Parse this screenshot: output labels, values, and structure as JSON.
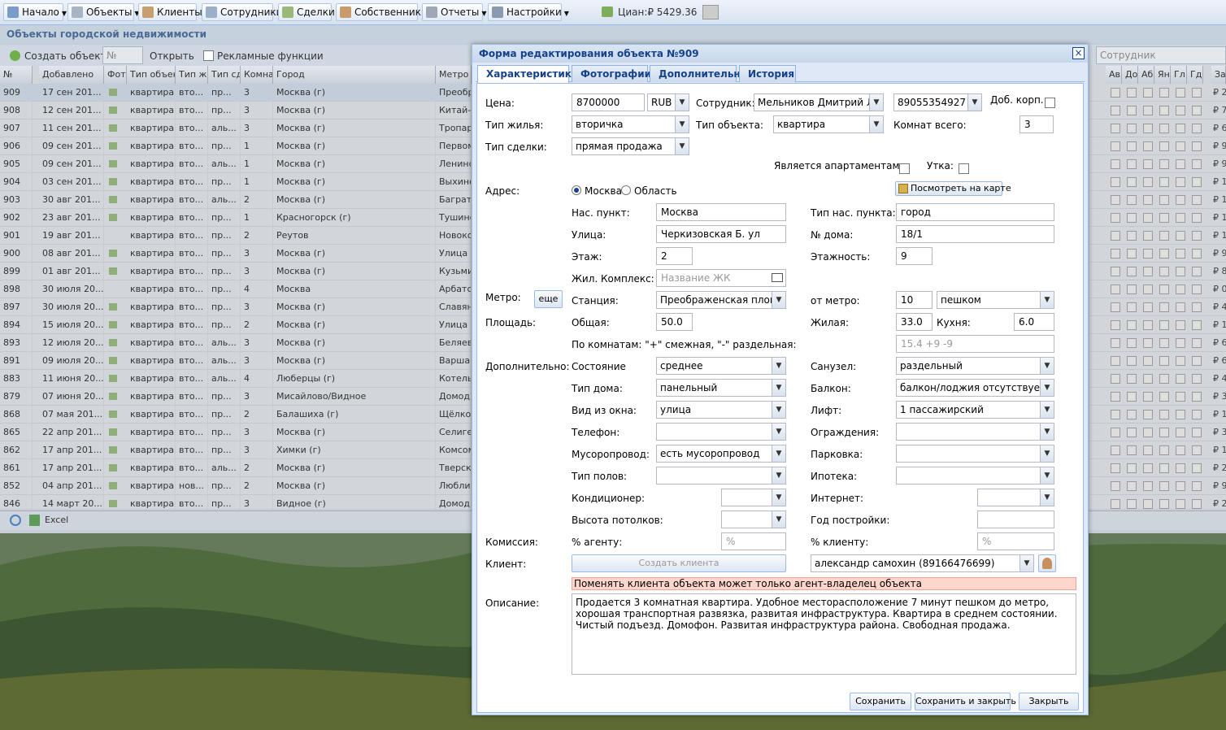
{
  "toolbar": {
    "items": [
      "Начало",
      "Объекты",
      "Клиенты",
      "Сотрудники",
      "Сделки",
      "Собственники",
      "Отчеты",
      "Настройки"
    ],
    "cian": "Циан:₽ 5429.36"
  },
  "panel": {
    "title": "Объекты городской недвижимости",
    "create": "Создать объект",
    "num_placeholder": "№",
    "open": "Открыть",
    "ads": "Рекламные функции",
    "employee_placeholder": "Сотрудник",
    "excel": "Excel"
  },
  "grid": {
    "headers": [
      "№",
      "Добавлено",
      "Фото",
      "Тип объект",
      "Тип жи",
      "Тип сд",
      "Комнат",
      "Город",
      "Метро"
    ],
    "right_headers": [
      "Ав",
      "До",
      "Аб",
      "Ян",
      "Гл",
      "Гд",
      "Затрат"
    ],
    "rows": [
      [
        "909",
        "17 сен 201...",
        "квартира",
        "вто...",
        "пр...",
        "3",
        "Москва (г)",
        "Преобр",
        "₽ 2..."
      ],
      [
        "908",
        "12 сен 201...",
        "квартира",
        "вто...",
        "пр...",
        "3",
        "Москва (г)",
        "Китай-г",
        "₽ 7..."
      ],
      [
        "907",
        "11 сен 201...",
        "квартира",
        "вто...",
        "аль...",
        "3",
        "Москва (г)",
        "Тропар",
        "₽ 6..."
      ],
      [
        "906",
        "09 сен 201...",
        "квартира",
        "вто...",
        "пр...",
        "1",
        "Москва (г)",
        "Первом",
        "₽ 9..."
      ],
      [
        "905",
        "09 сен 201...",
        "квартира",
        "вто...",
        "аль...",
        "1",
        "Москва (г)",
        "Ленинс",
        "₽ 9..."
      ],
      [
        "904",
        "03 сен 201...",
        "квартира",
        "вто...",
        "пр...",
        "1",
        "Москва (г)",
        "Выхино",
        "₽ 1..."
      ],
      [
        "903",
        "30 авг 201...",
        "квартира",
        "вто...",
        "аль...",
        "2",
        "Москва (г)",
        "Багратн",
        "₽ 1..."
      ],
      [
        "902",
        "23 авг 201...",
        "квартира",
        "вто...",
        "пр...",
        "1",
        "Красногорск (г)",
        "Тушинс",
        "₽ 1..."
      ],
      [
        "901",
        "19 авг 201...",
        "квартира",
        "вто...",
        "пр...",
        "2",
        "Реутов",
        "Новоко",
        "₽ 1..."
      ],
      [
        "900",
        "08 авг 201...",
        "квартира",
        "вто...",
        "пр...",
        "3",
        "Москва (г)",
        "Улица А",
        "₽ 9..."
      ],
      [
        "899",
        "01 авг 201...",
        "квартира",
        "вто...",
        "пр...",
        "3",
        "Москва (г)",
        "Кузьми",
        "₽ 8..."
      ],
      [
        "898",
        "30 июля 20...",
        "квартира",
        "вто...",
        "пр...",
        "4",
        "Москва",
        "Арбатск",
        "₽ 0..."
      ],
      [
        "897",
        "30 июля 20...",
        "квартира",
        "вто...",
        "пр...",
        "3",
        "Москва (г)",
        "Славян",
        "₽ 4..."
      ],
      [
        "894",
        "15 июля 20...",
        "квартира",
        "вто...",
        "пр...",
        "2",
        "Москва (г)",
        "Улица Е",
        "₽ 1..."
      ],
      [
        "893",
        "12 июля 20...",
        "квартира",
        "вто...",
        "аль...",
        "3",
        "Москва (г)",
        "Беляев",
        "₽ 6..."
      ],
      [
        "891",
        "09 июля 20...",
        "квартира",
        "вто...",
        "аль...",
        "3",
        "Москва (г)",
        "Варшав",
        "₽ 6..."
      ],
      [
        "883",
        "11 июня 20...",
        "квартира",
        "вто...",
        "аль...",
        "4",
        "Люберцы (г)",
        "Котель",
        "₽ 4..."
      ],
      [
        "879",
        "07 июня 20...",
        "квартира",
        "вто...",
        "пр...",
        "3",
        "Мисайлово/Видное",
        "Домод",
        "₽ 3..."
      ],
      [
        "868",
        "07 мая 201...",
        "квартира",
        "вто...",
        "пр...",
        "2",
        "Балашиха (г)",
        "Щёлков",
        "₽ 1..."
      ],
      [
        "865",
        "22 апр 201...",
        "квартира",
        "вто...",
        "пр...",
        "3",
        "Москва (г)",
        "Селигер",
        "₽ 3..."
      ],
      [
        "862",
        "17 апр 201...",
        "квартира",
        "вто...",
        "пр...",
        "3",
        "Химки (г)",
        "Комсом",
        "₽ 1..."
      ],
      [
        "861",
        "17 апр 201...",
        "квартира",
        "вто...",
        "аль...",
        "2",
        "Москва (г)",
        "Тверска",
        "₽ 2..."
      ],
      [
        "852",
        "04 апр 201...",
        "квартира",
        "нов...",
        "пр...",
        "2",
        "Москва (г)",
        "Люблин",
        "₽ 9..."
      ],
      [
        "846",
        "14 март 20...",
        "квартира",
        "вто...",
        "пр...",
        "3",
        "Видное (г)",
        "Домод",
        "₽ 2..."
      ]
    ]
  },
  "dialog": {
    "title": "Форма редактирования объекта №909",
    "tabs": [
      "Характеристики",
      "Фотографии",
      "Дополнительно",
      "История"
    ],
    "labels": {
      "price": "Цена:",
      "employee": "Сотрудник:",
      "extra_corp": "Доб. корп.",
      "housing_type": "Тип жилья:",
      "object_type": "Тип объекта:",
      "rooms_total": "Комнат всего:",
      "deal_type": "Тип сделки:",
      "apartments": "Является апартаментами:",
      "duck": "Утка:",
      "address": "Адрес:",
      "moscow": "Москва",
      "region": "Область",
      "map": "Посмотреть на карте",
      "settlement": "Нас. пункт:",
      "settlement_type": "Тип нас. пункта:",
      "street": "Улица:",
      "house": "№ дома:",
      "floor": "Этаж:",
      "floors": "Этажность:",
      "complex": "Жил. Комплекс:",
      "metro": "Метро:",
      "more": "еще",
      "station": "Станция:",
      "from_metro": "от метро:",
      "area": "Площадь:",
      "total": "Общая:",
      "living": "Жилая:",
      "kitchen": "Кухня:",
      "by_rooms": "По комнатам: \"+\" смежная, \"-\" раздельная:",
      "additional": "Дополнительно:",
      "condition": "Состояние",
      "bathroom": "Санузел:",
      "house_type": "Тип дома:",
      "balcony": "Балкон:",
      "window_view": "Вид из окна:",
      "lift": "Лифт:",
      "phone": "Телефон:",
      "fence": "Ограждения:",
      "garbage": "Мусоропровод:",
      "parking": "Парковка:",
      "floor_type": "Тип полов:",
      "mortgage": "Ипотека:",
      "aircon": "Кондиционер:",
      "internet": "Интернет:",
      "ceiling": "Высота потолков:",
      "built_year": "Год постройки:",
      "commission": "Комиссия:",
      "agent_pct": "% агенту:",
      "client_pct": "% клиенту:",
      "client": "Клиент:",
      "create_client": "Создать клиента",
      "description": "Описание:"
    },
    "values": {
      "price": "8700000",
      "currency": "RUB",
      "employee": "Мельников Дмитрий Лео",
      "phone": "89055354927",
      "housing_type": "вторичка",
      "object_type": "квартира",
      "rooms_total": "3",
      "deal_type": "прямая продажа",
      "settlement": "Москва",
      "settlement_type": "город",
      "street": "Черкизовская Б. ул",
      "house": "18/1",
      "floor": "2",
      "floors": "9",
      "complex_placeholder": "Название ЖК",
      "station": "Преображенская площа",
      "from_metro": "10",
      "from_metro_mode": "пешком",
      "total": "50.0",
      "living": "33.0",
      "kitchen": "6.0",
      "rooms_placeholder": "15.4 +9 -9",
      "condition": "среднее",
      "bathroom": "раздельный",
      "house_type": "панельный",
      "balcony": "балкон/лоджия отсутствует",
      "window_view": "улица",
      "lift": "1 пассажирский",
      "phone_opt": "",
      "fence": "",
      "garbage": "есть мусоропровод",
      "parking": "",
      "floor_type": "",
      "mortgage": "",
      "aircon": "",
      "internet": "",
      "ceiling": "",
      "built_year": "",
      "agent_pct_placeholder": "%",
      "client_pct_placeholder": "%",
      "client": "александр  самохин (89166476699)"
    },
    "warning": "Поменять клиента объекта может только агент-владелец объекта",
    "description": "Продается 3 комнатная квартира. Удобное месторасположение 7 минут пешком до метро, хорошая транспортная развязка, развитая инфраструктура. Квартира в среднем состоянии. Чистый подъезд. Домофон. Развитая инфраструктура района.  Свободная продажа.",
    "buttons": {
      "save": "Сохранить",
      "save_close": "Сохранить и закрыть",
      "close": "Закрыть"
    }
  }
}
